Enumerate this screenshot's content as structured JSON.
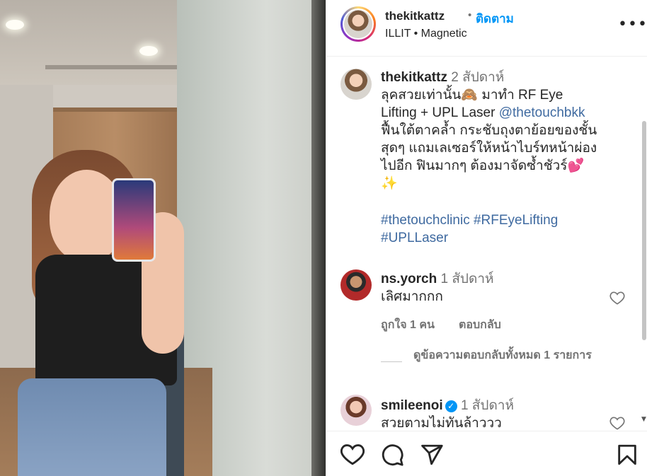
{
  "header": {
    "username": "thekitkattz",
    "dot": "•",
    "follow_label": "ติดตาม",
    "song": "ILLIT • Magnetic",
    "more_label": "•••"
  },
  "caption": {
    "username": "thekitkattz",
    "time": "2 สัปดาห์",
    "text_lines": [
      "ลุคสวยเท่านั้น🙈 มาทำ RF Eye",
      "Lifting + UPL Laser ",
      "ฟื้นใต้ตาคล้ำ กระชับถุงตาย้อยของชั้น",
      "สุดๆ แถมเลเซอร์ให้หน้าไบร์ทหน้าผ่อง",
      "ไปอีก ฟินมากๆ ต้องมาจัดซ้ำชัวร์💕",
      "✨"
    ],
    "mention": "@thetouchbkk",
    "hashtags_line1": "#thetouchclinic #RFEyeLifting",
    "hashtags_line2": "#UPLLaser"
  },
  "comments": [
    {
      "username": "ns.yorch",
      "time": "1 สัปดาห์",
      "text": "เลิศมากกก",
      "likes": "ถูกใจ 1 คน",
      "reply_label": "ตอบกลับ",
      "view_replies": "ดูข้อความตอบกลับทั้งหมด 1 รายการ"
    },
    {
      "username": "smileenoi",
      "verified": "✓",
      "time": "1 สัปดาห์",
      "text": "สวยตามไม่ทันล้าววว"
    }
  ],
  "icons": {
    "like": "heart-icon",
    "comment": "comment-icon",
    "share": "share-icon",
    "save": "bookmark-icon"
  },
  "colors": {
    "accent": "#0095f6",
    "link": "#3f6aa0",
    "muted": "#737373",
    "text": "#262626"
  }
}
